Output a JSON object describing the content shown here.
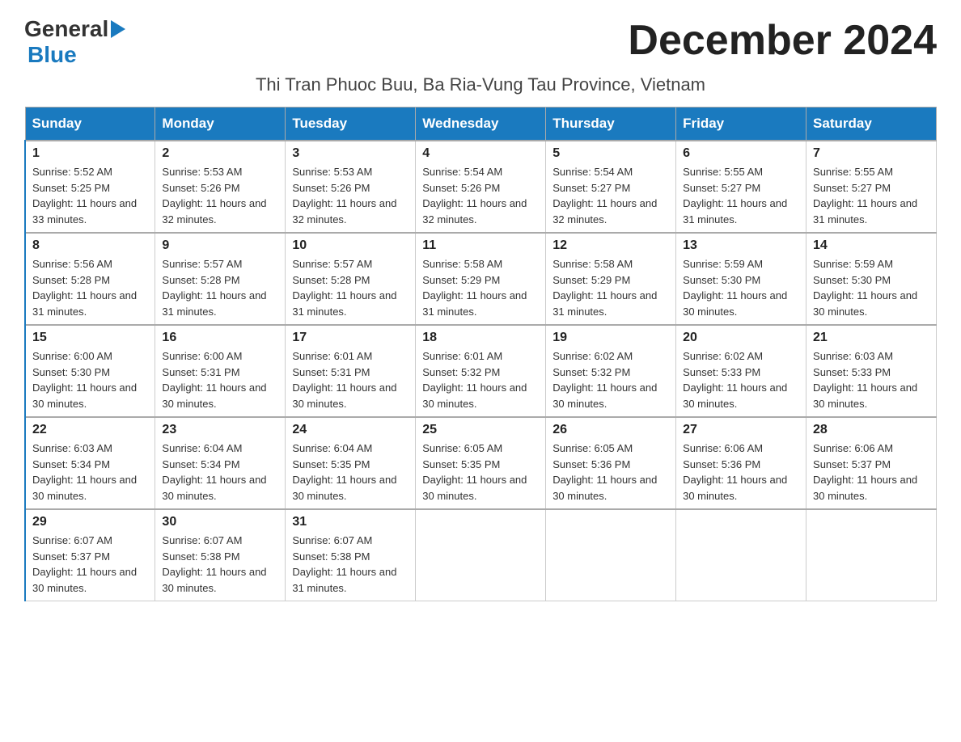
{
  "header": {
    "logo_general": "General",
    "logo_blue": "Blue",
    "month_title": "December 2024",
    "subtitle": "Thi Tran Phuoc Buu, Ba Ria-Vung Tau Province, Vietnam"
  },
  "calendar": {
    "days_of_week": [
      "Sunday",
      "Monday",
      "Tuesday",
      "Wednesday",
      "Thursday",
      "Friday",
      "Saturday"
    ],
    "weeks": [
      [
        {
          "day": "1",
          "sunrise": "5:52 AM",
          "sunset": "5:25 PM",
          "daylight": "11 hours and 33 minutes."
        },
        {
          "day": "2",
          "sunrise": "5:53 AM",
          "sunset": "5:26 PM",
          "daylight": "11 hours and 32 minutes."
        },
        {
          "day": "3",
          "sunrise": "5:53 AM",
          "sunset": "5:26 PM",
          "daylight": "11 hours and 32 minutes."
        },
        {
          "day": "4",
          "sunrise": "5:54 AM",
          "sunset": "5:26 PM",
          "daylight": "11 hours and 32 minutes."
        },
        {
          "day": "5",
          "sunrise": "5:54 AM",
          "sunset": "5:27 PM",
          "daylight": "11 hours and 32 minutes."
        },
        {
          "day": "6",
          "sunrise": "5:55 AM",
          "sunset": "5:27 PM",
          "daylight": "11 hours and 31 minutes."
        },
        {
          "day": "7",
          "sunrise": "5:55 AM",
          "sunset": "5:27 PM",
          "daylight": "11 hours and 31 minutes."
        }
      ],
      [
        {
          "day": "8",
          "sunrise": "5:56 AM",
          "sunset": "5:28 PM",
          "daylight": "11 hours and 31 minutes."
        },
        {
          "day": "9",
          "sunrise": "5:57 AM",
          "sunset": "5:28 PM",
          "daylight": "11 hours and 31 minutes."
        },
        {
          "day": "10",
          "sunrise": "5:57 AM",
          "sunset": "5:28 PM",
          "daylight": "11 hours and 31 minutes."
        },
        {
          "day": "11",
          "sunrise": "5:58 AM",
          "sunset": "5:29 PM",
          "daylight": "11 hours and 31 minutes."
        },
        {
          "day": "12",
          "sunrise": "5:58 AM",
          "sunset": "5:29 PM",
          "daylight": "11 hours and 31 minutes."
        },
        {
          "day": "13",
          "sunrise": "5:59 AM",
          "sunset": "5:30 PM",
          "daylight": "11 hours and 30 minutes."
        },
        {
          "day": "14",
          "sunrise": "5:59 AM",
          "sunset": "5:30 PM",
          "daylight": "11 hours and 30 minutes."
        }
      ],
      [
        {
          "day": "15",
          "sunrise": "6:00 AM",
          "sunset": "5:30 PM",
          "daylight": "11 hours and 30 minutes."
        },
        {
          "day": "16",
          "sunrise": "6:00 AM",
          "sunset": "5:31 PM",
          "daylight": "11 hours and 30 minutes."
        },
        {
          "day": "17",
          "sunrise": "6:01 AM",
          "sunset": "5:31 PM",
          "daylight": "11 hours and 30 minutes."
        },
        {
          "day": "18",
          "sunrise": "6:01 AM",
          "sunset": "5:32 PM",
          "daylight": "11 hours and 30 minutes."
        },
        {
          "day": "19",
          "sunrise": "6:02 AM",
          "sunset": "5:32 PM",
          "daylight": "11 hours and 30 minutes."
        },
        {
          "day": "20",
          "sunrise": "6:02 AM",
          "sunset": "5:33 PM",
          "daylight": "11 hours and 30 minutes."
        },
        {
          "day": "21",
          "sunrise": "6:03 AM",
          "sunset": "5:33 PM",
          "daylight": "11 hours and 30 minutes."
        }
      ],
      [
        {
          "day": "22",
          "sunrise": "6:03 AM",
          "sunset": "5:34 PM",
          "daylight": "11 hours and 30 minutes."
        },
        {
          "day": "23",
          "sunrise": "6:04 AM",
          "sunset": "5:34 PM",
          "daylight": "11 hours and 30 minutes."
        },
        {
          "day": "24",
          "sunrise": "6:04 AM",
          "sunset": "5:35 PM",
          "daylight": "11 hours and 30 minutes."
        },
        {
          "day": "25",
          "sunrise": "6:05 AM",
          "sunset": "5:35 PM",
          "daylight": "11 hours and 30 minutes."
        },
        {
          "day": "26",
          "sunrise": "6:05 AM",
          "sunset": "5:36 PM",
          "daylight": "11 hours and 30 minutes."
        },
        {
          "day": "27",
          "sunrise": "6:06 AM",
          "sunset": "5:36 PM",
          "daylight": "11 hours and 30 minutes."
        },
        {
          "day": "28",
          "sunrise": "6:06 AM",
          "sunset": "5:37 PM",
          "daylight": "11 hours and 30 minutes."
        }
      ],
      [
        {
          "day": "29",
          "sunrise": "6:07 AM",
          "sunset": "5:37 PM",
          "daylight": "11 hours and 30 minutes."
        },
        {
          "day": "30",
          "sunrise": "6:07 AM",
          "sunset": "5:38 PM",
          "daylight": "11 hours and 30 minutes."
        },
        {
          "day": "31",
          "sunrise": "6:07 AM",
          "sunset": "5:38 PM",
          "daylight": "11 hours and 31 minutes."
        },
        null,
        null,
        null,
        null
      ]
    ]
  }
}
